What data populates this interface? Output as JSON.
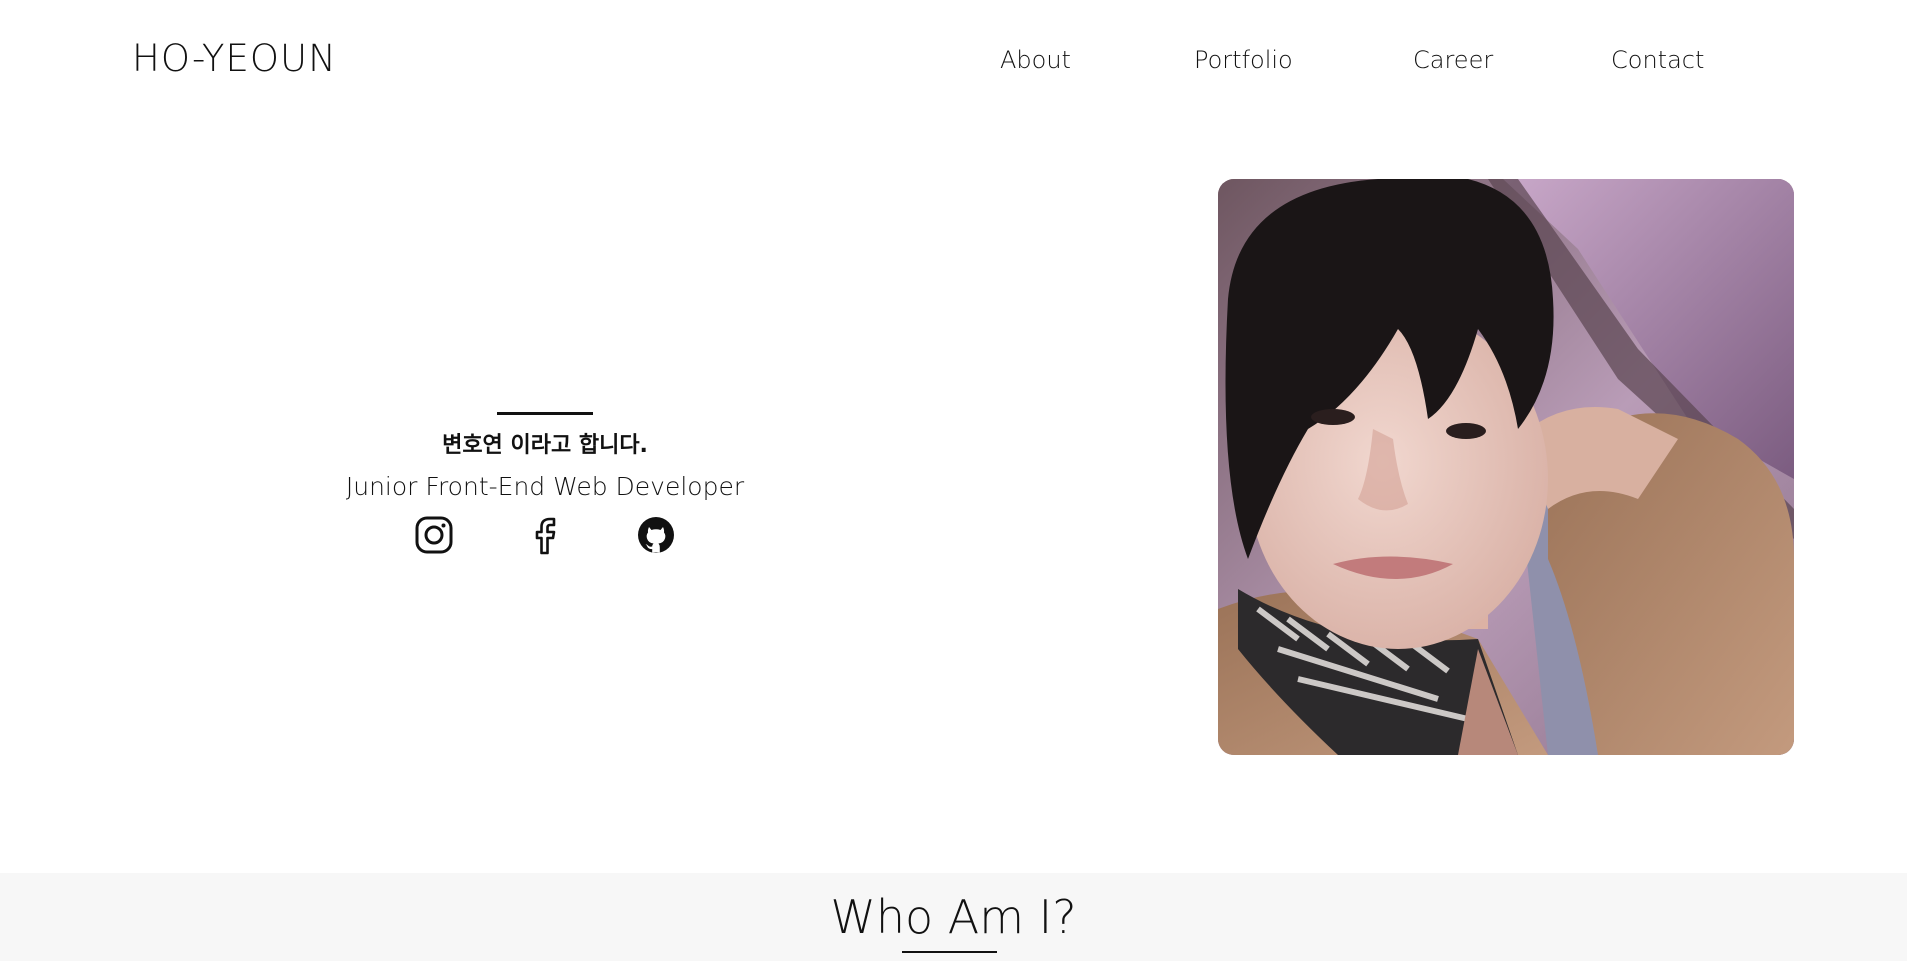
{
  "header": {
    "logo": "HO-YEOUN",
    "nav": [
      {
        "label": "About"
      },
      {
        "label": "Portfolio"
      },
      {
        "label": "Career"
      },
      {
        "label": "Contact"
      }
    ]
  },
  "intro": {
    "greeting": "변호연 이라고 합니다.",
    "role": "Junior Front-End Web Developer",
    "socials": [
      {
        "icon": "instagram-icon"
      },
      {
        "icon": "facebook-icon"
      },
      {
        "icon": "github-icon"
      }
    ]
  },
  "profile": {
    "photo": "profile-photo"
  },
  "section": {
    "title": "Who Am I?"
  }
}
